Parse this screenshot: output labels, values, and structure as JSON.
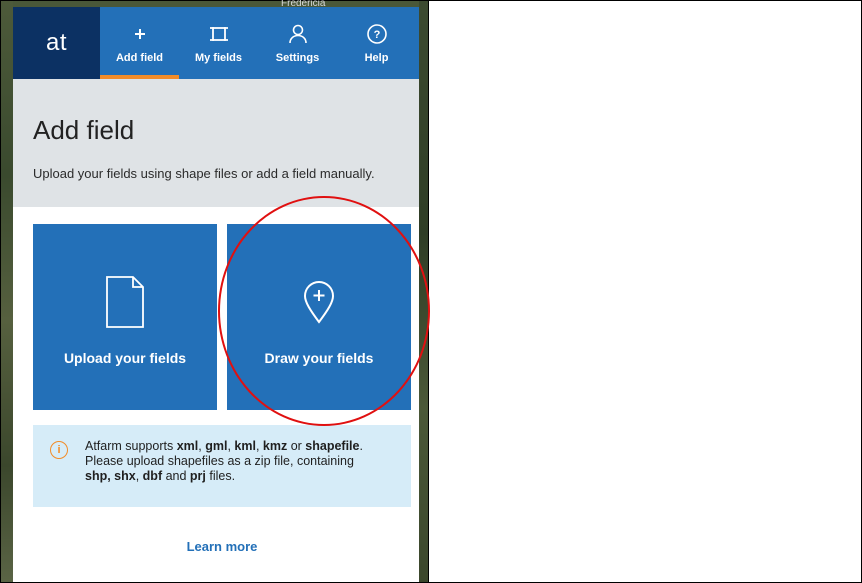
{
  "map": {
    "place_label": "Fredericia"
  },
  "nav": {
    "logo": "at",
    "items": [
      {
        "label": "Add field",
        "icon": "plus-icon",
        "active": true
      },
      {
        "label": "My fields",
        "icon": "square-bracket-icon",
        "active": false
      },
      {
        "label": "Settings",
        "icon": "user-icon",
        "active": false
      },
      {
        "label": "Help",
        "icon": "question-circle-icon",
        "active": false
      }
    ]
  },
  "header": {
    "title": "Add field",
    "subtitle": "Upload your fields using shape files or add a field manually."
  },
  "cards": {
    "upload": {
      "label": "Upload your fields",
      "icon": "file-icon"
    },
    "draw": {
      "label": "Draw your fields",
      "icon": "map-pin-plus-icon"
    }
  },
  "info": {
    "icon": "info-icon",
    "t1": "Atfarm supports ",
    "f1": "xml",
    "s1": ", ",
    "f2": "gml",
    "s2": ", ",
    "f3": "kml",
    "s3": ", ",
    "f4": "kmz",
    "t2": " or ",
    "f5": "shapefile",
    "t3": ".",
    "t4": "Please upload shapefiles as a zip file, containing",
    "f6": "shp, shx",
    "s6": ", ",
    "f7": "dbf",
    "t5": " and ",
    "f8": "prj",
    "t6": " files."
  },
  "learn_more": "Learn more",
  "colors": {
    "primary": "#2370b8",
    "logo_bg": "#0c3163",
    "accent": "#f28c28",
    "header_bg": "#dfe3e6",
    "info_bg": "#d6ecf8",
    "annotation": "#e01010"
  }
}
